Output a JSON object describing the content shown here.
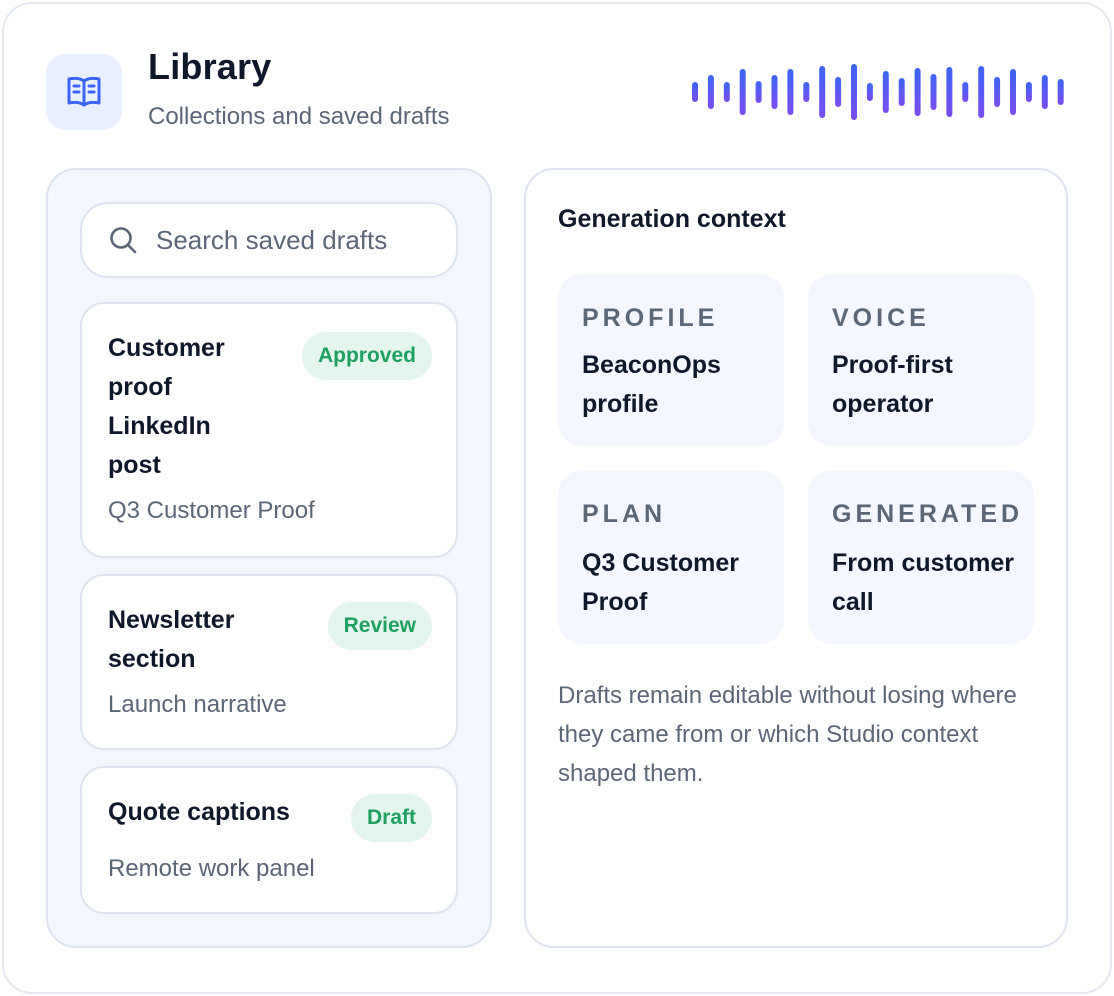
{
  "header": {
    "title": "Library",
    "subtitle": "Collections and saved drafts",
    "icon": "book-open-icon"
  },
  "colors": {
    "accent": "#3b66f5",
    "accent_end": "#7b4df0",
    "approved": "#1fa060",
    "badge_bg": "#e3f5ec",
    "panel_bg": "#f4f7fd"
  },
  "search": {
    "placeholder": "Search saved drafts",
    "value": ""
  },
  "drafts": [
    {
      "title": "Customer proof LinkedIn post",
      "subtitle": "Q3 Customer Proof",
      "status": "Approved"
    },
    {
      "title": "Newsletter section",
      "subtitle": "Launch narrative",
      "status": "Review"
    },
    {
      "title": "Quote captions",
      "subtitle": "Remote work panel",
      "status": "Draft"
    }
  ],
  "context": {
    "title": "Generation context",
    "tiles": [
      {
        "label": "PROFILE",
        "value": "BeaconOps profile"
      },
      {
        "label": "VOICE",
        "value": "Proof-first operator"
      },
      {
        "label": "PLAN",
        "value": "Q3 Customer Proof"
      },
      {
        "label": "GENERATED",
        "value": "From customer call"
      }
    ],
    "description": "Drafts remain editable without losing where they came from or which Studio context shaped them."
  }
}
